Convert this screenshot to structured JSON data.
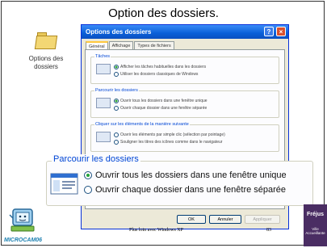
{
  "slide": {
    "title": "Option des dossiers.",
    "footer": "Plus loin avec Windows XP",
    "page_number": "83",
    "brand": "MICROCAM06",
    "logo_title": "Fréjus",
    "logo_sub": "Ville Accueillante"
  },
  "desktop_icon": {
    "label_line1": "Options des",
    "label_line2": "dossiers"
  },
  "window": {
    "title": "Options des dossiers",
    "help_glyph": "?",
    "close_glyph": "×",
    "tabs": [
      "Général",
      "Affichage",
      "Types de fichiers"
    ],
    "groups": {
      "tasks": {
        "title": "Tâches",
        "opt1": "Afficher les tâches habituelles dans les dossiers",
        "opt2": "Utiliser les dossiers classiques de Windows"
      },
      "browse": {
        "title": "Parcourir les dossiers",
        "opt1": "Ouvrir tous les dossiers dans une fenêtre unique",
        "opt2": "Ouvrir chaque dossier dans une fenêtre séparée"
      },
      "click": {
        "title": "Cliquer sur les éléments de la manière suivante",
        "opt1": "Ouvrir les éléments par simple clic (sélection par pointage)",
        "opt2": "Souligner les titres des icônes comme dans le navigateur"
      }
    },
    "buttons": {
      "ok": "OK",
      "cancel": "Annuler",
      "apply": "Appliquer"
    }
  },
  "zoom": {
    "title": "Parcourir les dossiers",
    "opt1": "Ouvrir tous les dossiers dans une fenêtre unique",
    "opt2": "Ouvrir chaque dossier dans une fenêtre séparée",
    "selected": 1
  },
  "colors": {
    "xp_title_blue": "#0a5fd8",
    "group_title_blue": "#0046d5",
    "radio_green": "#22a33a",
    "logo_purple": "#4a2d63"
  }
}
